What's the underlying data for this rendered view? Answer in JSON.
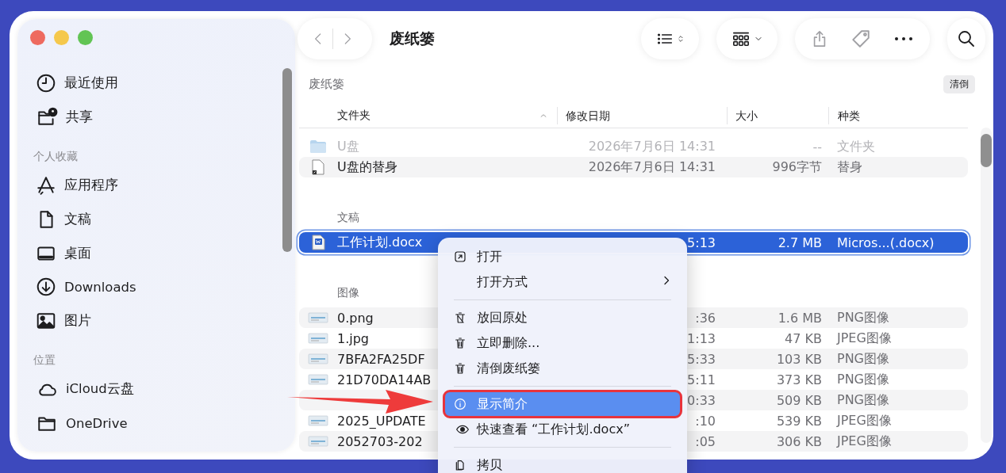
{
  "window": {
    "title": "废纸篓"
  },
  "sidebar": {
    "sections": [
      {
        "items": [
          {
            "label": "最近使用"
          },
          {
            "label": "共享"
          }
        ]
      },
      {
        "header": "个人收藏",
        "items": [
          {
            "label": "应用程序"
          },
          {
            "label": "文稿"
          },
          {
            "label": "桌面"
          },
          {
            "label": "Downloads"
          },
          {
            "label": "图片"
          }
        ]
      },
      {
        "header": "位置",
        "items": [
          {
            "label": "iCloud云盘"
          },
          {
            "label": "OneDrive"
          }
        ]
      }
    ]
  },
  "path_bar": {
    "label": "废纸篓",
    "button": "清倒"
  },
  "table": {
    "columns": [
      "文件夹",
      "修改日期",
      "大小",
      "种类"
    ],
    "groups": [
      {
        "rows": [
          {
            "kind": "folder",
            "name": "U盘",
            "date": "2026年7月6日 14:31",
            "size": "--",
            "type": "文件夹",
            "dimmed": true,
            "selected": false
          },
          {
            "kind": "alias",
            "name": "U盘的替身",
            "date": "2026年7月6日 14:31",
            "size": "996字节",
            "type": "替身",
            "dimmed": false,
            "selected": false
          }
        ]
      },
      {
        "label": "文稿",
        "rows": [
          {
            "kind": "document",
            "name": "工作计划.docx",
            "date": "5:13",
            "size": "2.7 MB",
            "type": "Micros...(.docx)",
            "dimmed": false,
            "selected": true
          }
        ]
      },
      {
        "label": "图像",
        "rows": [
          {
            "kind": "image",
            "name": "0.png",
            "date": ":36",
            "size": "1.6 MB",
            "type": "PNG图像",
            "dimmed": false,
            "selected": false
          },
          {
            "kind": "image",
            "name": "1.jpg",
            "date": "1:13",
            "size": "47 KB",
            "type": "JPEG图像",
            "dimmed": false,
            "selected": false
          },
          {
            "kind": "image",
            "name": "7BFA2FA25DF",
            "date": "5:33",
            "size": "103 KB",
            "type": "PNG图像",
            "dimmed": false,
            "selected": false
          },
          {
            "kind": "image",
            "name": "21D70DA14AB",
            "date": "5:11",
            "size": "373 KB",
            "type": "PNG图像",
            "dimmed": false,
            "selected": false
          },
          {
            "date": "0:33",
            "size": "509 KB",
            "type": "PNG图像",
            "dimmed": false,
            "selected": false
          },
          {
            "kind": "image",
            "name": "2025_UPDATE",
            "date": ":10",
            "size": "539 KB",
            "type": "JPEG图像",
            "dimmed": false,
            "selected": false
          },
          {
            "kind": "image",
            "name": "2052703-202",
            "date": ":05",
            "size": "306 KB",
            "type": "JPEG图像",
            "dimmed": false,
            "selected": false
          }
        ]
      }
    ]
  },
  "context_menu": {
    "groups": [
      [
        {
          "label": "打开",
          "selected": false,
          "submenu": false
        },
        {
          "label": "打开方式",
          "selected": false,
          "submenu": true
        }
      ],
      [
        {
          "label": "放回原处",
          "selected": false,
          "submenu": false
        },
        {
          "label": "立即删除...",
          "selected": false,
          "submenu": false
        },
        {
          "label": "清倒废纸篓",
          "selected": false,
          "submenu": false
        }
      ],
      [
        {
          "label": "显示简介",
          "selected": true,
          "submenu": false
        },
        {
          "label": "快速查看 “工作计划.docx”",
          "selected": false,
          "submenu": false
        }
      ],
      [
        {
          "label": "拷贝",
          "selected": false,
          "submenu": false
        }
      ]
    ]
  }
}
